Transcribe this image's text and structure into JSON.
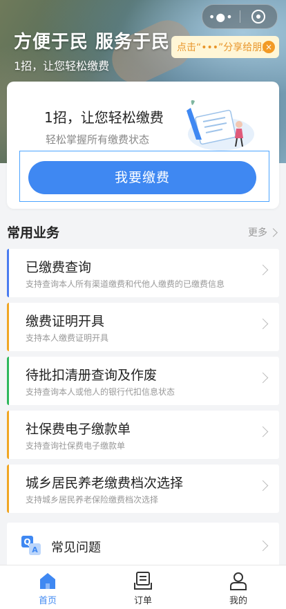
{
  "hero": {
    "title": "方便于民 服务于民",
    "subtitle": "1招，让您轻松缴费"
  },
  "capsule": {
    "menu_icon": "more-dots-icon",
    "close_icon": "target-icon"
  },
  "share_tip": {
    "text": "点击“•••”分享给朋友",
    "close_glyph": "×"
  },
  "pay_card": {
    "headline": "1招，让您轻松缴费",
    "subline": "轻松掌握所有缴费状态",
    "button_label": "我要缴费"
  },
  "section": {
    "title": "常用业务",
    "more_label": "更多"
  },
  "services": [
    {
      "name": "已缴费查询",
      "desc": "支持查询本人所有渠道缴费和代他人缴费的已缴费信息",
      "accent": "#4a7cf0"
    },
    {
      "name": "缴费证明开具",
      "desc": "支持本人缴费证明开具",
      "accent": "#f0a623"
    },
    {
      "name": "待批扣清册查询及作废",
      "desc": "支持查询本人或他人的银行代扣信息状态",
      "accent": "#2fb85c"
    },
    {
      "name": "社保费电子缴款单",
      "desc": "支持查询社保费电子缴款单",
      "accent": "#f0a623"
    },
    {
      "name": "城乡居民养老缴费档次选择",
      "desc": "支持城乡居民养老保险缴费档次选择",
      "accent": "#f0a623"
    }
  ],
  "faq": {
    "label": "常见问题",
    "icon": "qa-icon"
  },
  "tabs": [
    {
      "label": "首页",
      "icon": "home-icon",
      "active": true
    },
    {
      "label": "订单",
      "icon": "order-icon",
      "active": false
    },
    {
      "label": "我的",
      "icon": "profile-icon",
      "active": false
    }
  ],
  "colors": {
    "primary": "#3f88f2",
    "tip_text": "#e8952a"
  }
}
